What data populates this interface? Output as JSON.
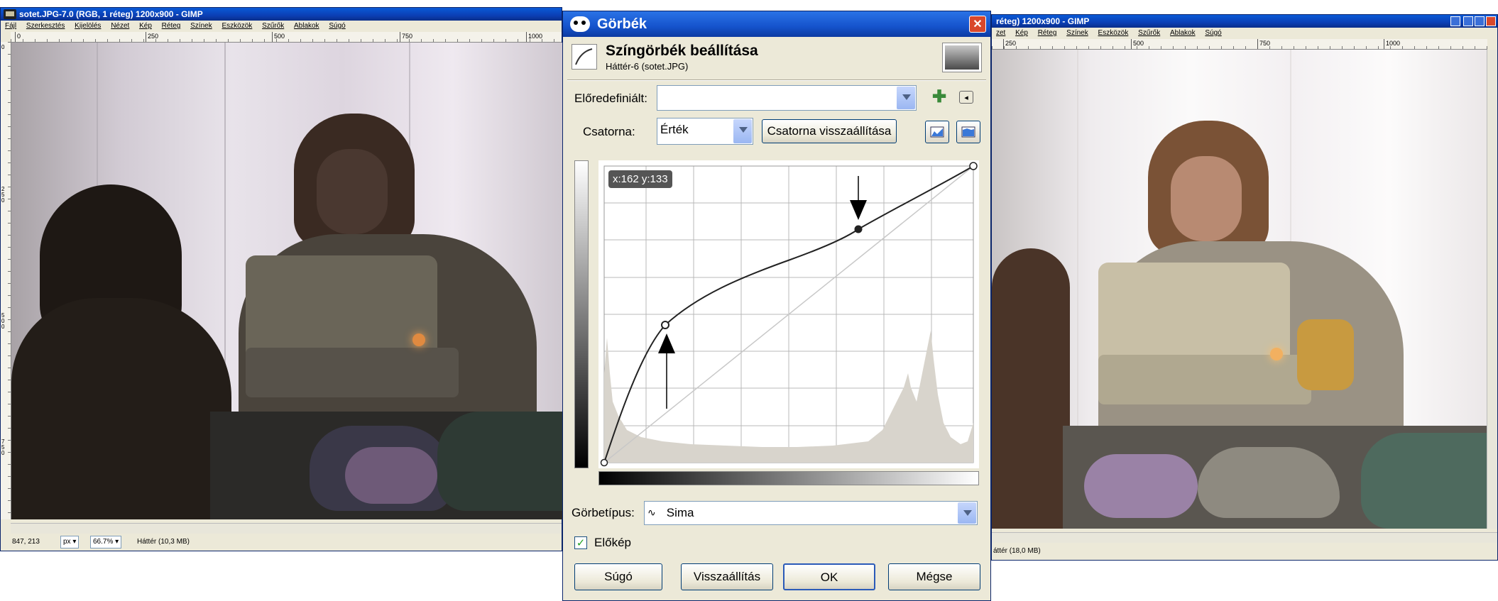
{
  "left_window": {
    "title": "sotet.JPG-7.0 (RGB, 1 réteg) 1200x900 - GIMP",
    "menu": [
      "Fájl",
      "Szerkesztés",
      "Kijelölés",
      "Nézet",
      "Kép",
      "Réteg",
      "Színek",
      "Eszközök",
      "Szűrők",
      "Ablakok",
      "Súgó"
    ],
    "ruler_labels": [
      "0",
      "250",
      "500",
      "750",
      "1000"
    ],
    "vruler_labels": [
      "0",
      "250",
      "500",
      "750"
    ],
    "status": {
      "coords": "847, 213",
      "unit": "px",
      "zoom": "66.7%",
      "layer_info": "Háttér (10,3 MB)"
    }
  },
  "right_window": {
    "title": "réteg) 1200x900 - GIMP",
    "menu": [
      "zet",
      "Kép",
      "Réteg",
      "Színek",
      "Eszközök",
      "Szűrők",
      "Ablakok",
      "Súgó"
    ],
    "ruler_labels": [
      "250",
      "500",
      "750",
      "1000"
    ],
    "status": {
      "layer_info": "áttér (18,0 MB)"
    }
  },
  "dialog": {
    "title": "Görbék",
    "close_label": "✕",
    "heading": "Színgörbék beállítása",
    "subheading": "Háttér-6 (sotet.JPG)",
    "preset_label": "Előredefiniált:",
    "preset_value": "",
    "channel_label": "Csatorna:",
    "channel_value": "Érték",
    "reset_channel_label": "Csatorna visszaállítása",
    "coord_readout": "x:162 y:133",
    "curve_type_label": "Görbetípus:",
    "curve_type_value": "Sima",
    "preview_label": "Előkép",
    "preview_checked": true,
    "buttons": {
      "help": "Súgó",
      "reset": "Visszaállítás",
      "ok": "OK",
      "cancel": "Mégse"
    }
  },
  "colors": {
    "xp_blue": "#0a46c8",
    "dialog_bg": "#ece9d8",
    "histogram": "#d8d4cc",
    "curve": "#222222"
  }
}
